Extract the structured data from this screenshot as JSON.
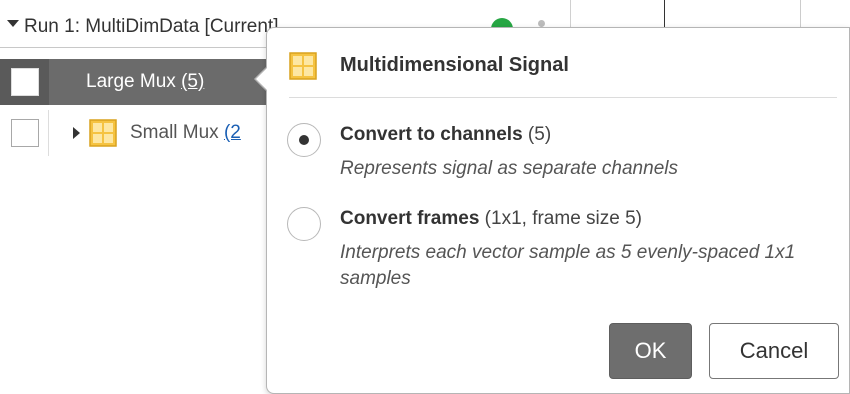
{
  "run_header": {
    "label": "Run 1: MultiDimData [Current]",
    "status_color": "#27a644"
  },
  "tree": {
    "rows": [
      {
        "label": "Large Mux",
        "count": "(5)",
        "selected": true,
        "icon": "multidimensional-grid-icon"
      },
      {
        "label": "Small Mux",
        "count": "(2",
        "selected": false,
        "icon": "multidimensional-grid-icon"
      }
    ]
  },
  "popup": {
    "icon": "multidimensional-grid-icon",
    "title": "Multidimensional Signal",
    "options": [
      {
        "title": "Convert to channels",
        "detail": " (5)",
        "description": "Represents signal as separate channels",
        "selected": true
      },
      {
        "title": "Convert frames",
        "detail": " (1x1, frame size 5)",
        "description": "Interprets each vector sample as 5 evenly-spaced 1x1 samples",
        "selected": false
      }
    ],
    "ok_label": "OK",
    "cancel_label": "Cancel"
  },
  "colors": {
    "selected_row": "#6b6b6b",
    "ok_button": "#6e6e6e",
    "grid_icon_fill": "#f5c342",
    "grid_icon_cell": "#fde7a3"
  }
}
